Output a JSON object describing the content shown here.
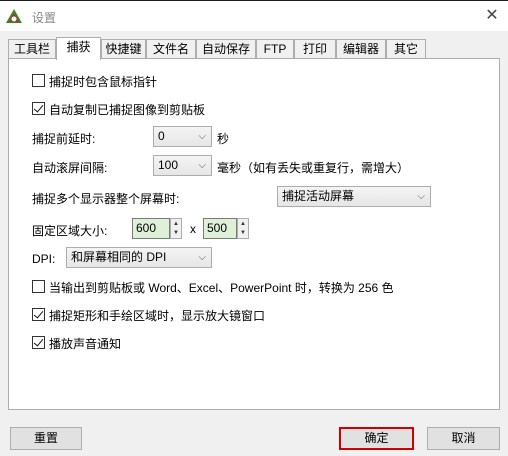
{
  "window": {
    "title": "设置"
  },
  "tabs": [
    "工具栏",
    "捕获",
    "快捷键",
    "文件名",
    "自动保存",
    "FTP",
    "打印",
    "编辑器",
    "其它"
  ],
  "options": {
    "include_cursor": {
      "label": "捕捉时包含鼠标指针",
      "checked": false
    },
    "auto_copy": {
      "label": "自动复制已捕捉图像到剪贴板",
      "checked": true
    },
    "delay": {
      "label": "捕捉前延时:",
      "value": "0",
      "unit": "秒"
    },
    "scroll_interval": {
      "label": "自动滚屏间隔:",
      "value": "100",
      "unit": "毫秒（如有丢失或重复行，需增大）"
    },
    "multi_monitor": {
      "label": "捕捉多个显示器整个屏幕时:",
      "value": "捕捉活动屏幕"
    },
    "fixed_region": {
      "label": "固定区域大小:",
      "width": "600",
      "separator": "x",
      "height": "500"
    },
    "dpi": {
      "label": "DPI:",
      "value": "和屏幕相同的 DPI"
    },
    "convert_256": {
      "label": "当输出到剪贴板或 Word、Excel、PowerPoint 时，转换为 256 色",
      "checked": false
    },
    "magnifier": {
      "label": "捕捉矩形和手绘区域时，显示放大镜窗口",
      "checked": true
    },
    "sound": {
      "label": "播放声音通知",
      "checked": true
    }
  },
  "buttons": {
    "reset": "重置",
    "ok": "确定",
    "cancel": "取消"
  },
  "colors": {
    "ok_highlight": "#d00000",
    "spin_bg": "#dff0d8"
  }
}
